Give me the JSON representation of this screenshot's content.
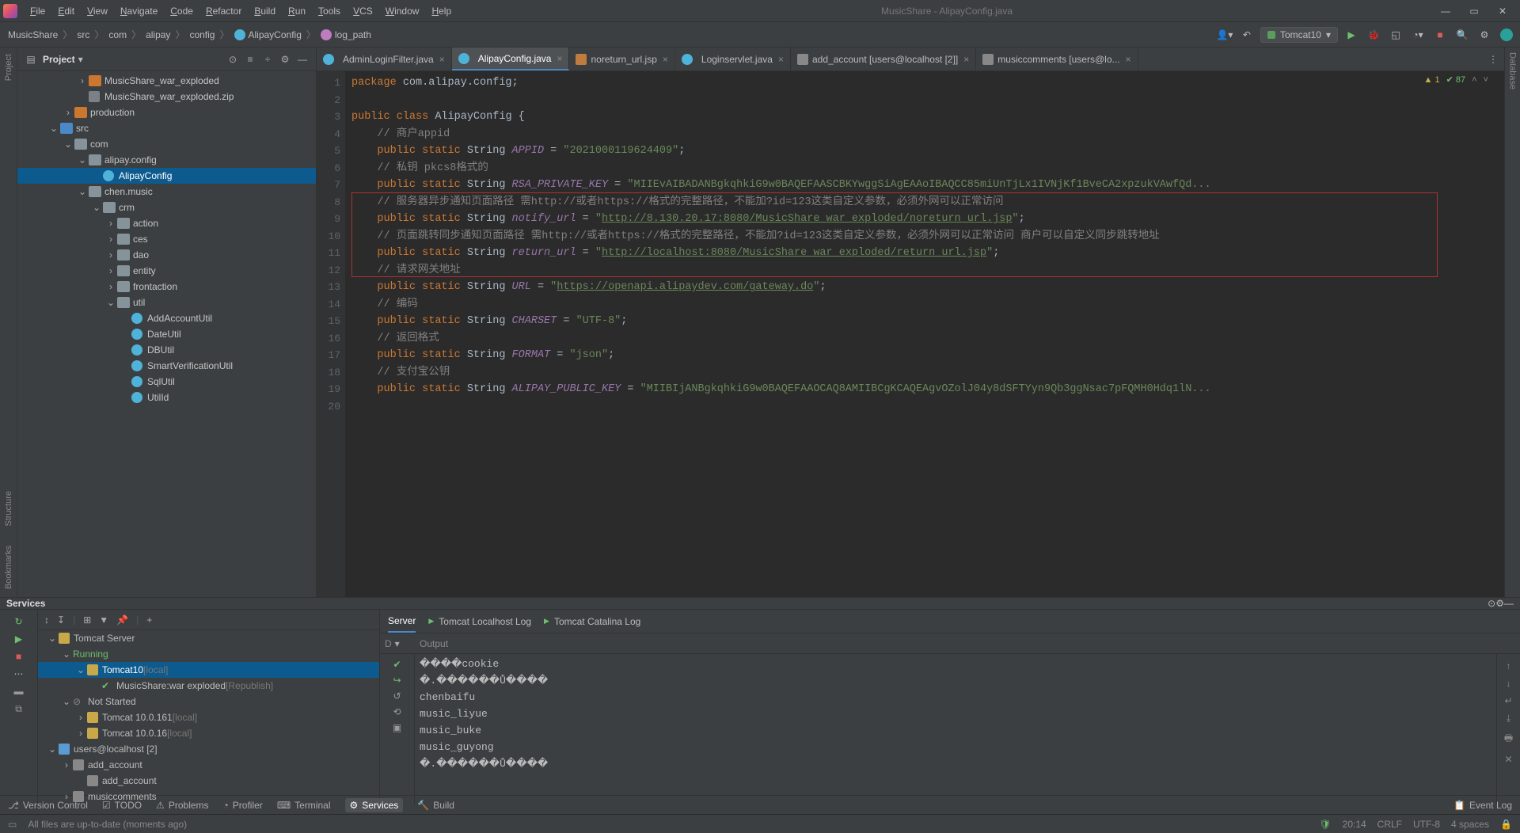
{
  "window": {
    "title": "MusicShare - AlipayConfig.java",
    "menus": [
      "File",
      "Edit",
      "View",
      "Navigate",
      "Code",
      "Refactor",
      "Build",
      "Run",
      "Tools",
      "VCS",
      "Window",
      "Help"
    ]
  },
  "breadcrumbs": [
    "MusicShare",
    "src",
    "com",
    "alipay",
    "config",
    "AlipayConfig",
    "log_path"
  ],
  "run_config": "Tomcat10",
  "project": {
    "title": "Project",
    "tree": [
      {
        "d": 3,
        "tw": ">",
        "ic": "folder orange",
        "t": "MusicShare_war_exploded"
      },
      {
        "d": 3,
        "tw": "",
        "ic": "zip",
        "t": "MusicShare_war_exploded.zip"
      },
      {
        "d": 2,
        "tw": ">",
        "ic": "folder orange",
        "t": "production"
      },
      {
        "d": 1,
        "tw": "v",
        "ic": "folder blue",
        "t": "src"
      },
      {
        "d": 2,
        "tw": "v",
        "ic": "folder",
        "t": "com"
      },
      {
        "d": 3,
        "tw": "v",
        "ic": "folder",
        "t": "alipay.config"
      },
      {
        "d": 4,
        "tw": "",
        "ic": "ficon",
        "t": "AlipayConfig",
        "sel": true
      },
      {
        "d": 3,
        "tw": "v",
        "ic": "folder",
        "t": "chen.music"
      },
      {
        "d": 4,
        "tw": "v",
        "ic": "folder",
        "t": "crm"
      },
      {
        "d": 5,
        "tw": ">",
        "ic": "folder",
        "t": "action"
      },
      {
        "d": 5,
        "tw": ">",
        "ic": "folder",
        "t": "ces"
      },
      {
        "d": 5,
        "tw": ">",
        "ic": "folder",
        "t": "dao"
      },
      {
        "d": 5,
        "tw": ">",
        "ic": "folder",
        "t": "entity"
      },
      {
        "d": 5,
        "tw": ">",
        "ic": "folder",
        "t": "frontaction"
      },
      {
        "d": 5,
        "tw": "v",
        "ic": "folder",
        "t": "util"
      },
      {
        "d": 6,
        "tw": "",
        "ic": "ficon",
        "t": "AddAccountUtil"
      },
      {
        "d": 6,
        "tw": "",
        "ic": "ficon",
        "t": "DateUtil"
      },
      {
        "d": 6,
        "tw": "",
        "ic": "ficon",
        "t": "DBUtil"
      },
      {
        "d": 6,
        "tw": "",
        "ic": "ficon",
        "t": "SmartVerificationUtil"
      },
      {
        "d": 6,
        "tw": "",
        "ic": "ficon",
        "t": "SqlUtil"
      },
      {
        "d": 6,
        "tw": "",
        "ic": "ficon",
        "t": "UtilId"
      }
    ]
  },
  "editor": {
    "tabs": [
      {
        "icon": "c",
        "label": "AdminLoginFilter.java",
        "active": false
      },
      {
        "icon": "c",
        "label": "AlipayConfig.java",
        "active": true
      },
      {
        "icon": "jsp",
        "label": "noreturn_url.jsp",
        "active": false
      },
      {
        "icon": "c",
        "label": "Loginservlet.java",
        "active": false
      },
      {
        "icon": "db",
        "label": "add_account [users@localhost [2]]",
        "active": false
      },
      {
        "icon": "db",
        "label": "musiccomments [users@lo...",
        "active": false
      }
    ],
    "inspection": {
      "warn": "1",
      "ok": "87"
    },
    "lines": [
      {
        "n": 1,
        "seg": [
          [
            "kw",
            "package "
          ],
          [
            "cls",
            "com.alipay.config"
          ],
          [
            "cls",
            ";"
          ]
        ]
      },
      {
        "n": 2,
        "seg": []
      },
      {
        "n": 3,
        "seg": [
          [
            "kw",
            "public class "
          ],
          [
            "cls",
            "AlipayConfig {"
          ]
        ]
      },
      {
        "n": 4,
        "seg": [
          [
            "",
            "    "
          ],
          [
            "cmt",
            "// 商户appid"
          ]
        ]
      },
      {
        "n": 5,
        "seg": [
          [
            "",
            "    "
          ],
          [
            "kw",
            "public static "
          ],
          [
            "cls",
            "String "
          ],
          [
            "fld",
            "APPID"
          ],
          [
            "cls",
            " = "
          ],
          [
            "str",
            "\"2021000119624409\""
          ],
          [
            "cls",
            ";"
          ]
        ]
      },
      {
        "n": 6,
        "seg": [
          [
            "",
            "    "
          ],
          [
            "cmt",
            "// 私钥 pkcs8格式的"
          ]
        ]
      },
      {
        "n": 7,
        "seg": [
          [
            "",
            "    "
          ],
          [
            "kw",
            "public static "
          ],
          [
            "cls",
            "String "
          ],
          [
            "fld",
            "RSA_PRIVATE_KEY"
          ],
          [
            "cls",
            " = "
          ],
          [
            "str",
            "\"MIIEvAIBADANBgkqhkiG9w0BAQEFAASCBKYwggSiAgEAAoIBAQCC85miUnTjLx1IVNjKf1BveCA2xpzukVAwfQd..."
          ]
        ]
      },
      {
        "n": 8,
        "seg": [
          [
            "",
            "    "
          ],
          [
            "cmt",
            "// 服务器异步通知页面路径 需http://或者https://格式的完整路径，不能加?id=123这类自定义参数，必须外网可以正常访问"
          ]
        ]
      },
      {
        "n": 9,
        "seg": [
          [
            "",
            "    "
          ],
          [
            "kw",
            "public static "
          ],
          [
            "cls",
            "String "
          ],
          [
            "fld",
            "notify_url"
          ],
          [
            "cls",
            " = "
          ],
          [
            "str",
            "\""
          ],
          [
            "lnk",
            "http://8.130.20.17:8080/MusicShare_war_exploded/noreturn_url.jsp"
          ],
          [
            "str",
            "\""
          ],
          [
            "cls",
            ";"
          ]
        ]
      },
      {
        "n": 10,
        "seg": [
          [
            "",
            "    "
          ],
          [
            "cmt",
            "// 页面跳转同步通知页面路径 需http://或者https://格式的完整路径，不能加?id=123这类自定义参数，必须外网可以正常访问 商户可以自定义同步跳转地址"
          ]
        ]
      },
      {
        "n": 11,
        "seg": [
          [
            "",
            "    "
          ],
          [
            "kw",
            "public static "
          ],
          [
            "cls",
            "String "
          ],
          [
            "fld",
            "return_url"
          ],
          [
            "cls",
            " = "
          ],
          [
            "str",
            "\""
          ],
          [
            "lnk",
            "http://localhost:8080/MusicShare_war_exploded/return_url.jsp"
          ],
          [
            "str",
            "\""
          ],
          [
            "cls",
            ";"
          ]
        ]
      },
      {
        "n": 12,
        "seg": [
          [
            "",
            "    "
          ],
          [
            "cmt",
            "// 请求网关地址"
          ]
        ]
      },
      {
        "n": 13,
        "seg": [
          [
            "",
            "    "
          ],
          [
            "kw",
            "public static "
          ],
          [
            "cls",
            "String "
          ],
          [
            "fld",
            "URL"
          ],
          [
            "cls",
            " = "
          ],
          [
            "str",
            "\""
          ],
          [
            "lnk",
            "https://openapi.alipaydev.com/gateway.do"
          ],
          [
            "str",
            "\""
          ],
          [
            "cls",
            ";"
          ]
        ]
      },
      {
        "n": 14,
        "seg": [
          [
            "",
            "    "
          ],
          [
            "cmt",
            "// 编码"
          ]
        ]
      },
      {
        "n": 15,
        "seg": [
          [
            "",
            "    "
          ],
          [
            "kw",
            "public static "
          ],
          [
            "cls",
            "String "
          ],
          [
            "fld",
            "CHARSET"
          ],
          [
            "cls",
            " = "
          ],
          [
            "str",
            "\"UTF-8\""
          ],
          [
            "cls",
            ";"
          ]
        ]
      },
      {
        "n": 16,
        "seg": [
          [
            "",
            "    "
          ],
          [
            "cmt",
            "// 返回格式"
          ]
        ]
      },
      {
        "n": 17,
        "seg": [
          [
            "",
            "    "
          ],
          [
            "kw",
            "public static "
          ],
          [
            "cls",
            "String "
          ],
          [
            "fld",
            "FORMAT"
          ],
          [
            "cls",
            " = "
          ],
          [
            "str",
            "\"json\""
          ],
          [
            "cls",
            ";"
          ]
        ]
      },
      {
        "n": 18,
        "seg": [
          [
            "",
            "    "
          ],
          [
            "cmt",
            "// 支付宝公钥"
          ]
        ]
      },
      {
        "n": 19,
        "seg": [
          [
            "",
            "    "
          ],
          [
            "kw",
            "public static "
          ],
          [
            "cls",
            "String "
          ],
          [
            "fld",
            "ALIPAY_PUBLIC_KEY"
          ],
          [
            "cls",
            " = "
          ],
          [
            "str",
            "\"MIIBIjANBgkqhkiG9w0BAQEFAAOCAQ8AMIIBCgKCAQEAgvOZolJ04y8dSFTYyn9Qb3ggNsac7pFQMH0Hdq1lN..."
          ]
        ]
      },
      {
        "n": 20,
        "seg": []
      }
    ],
    "highlight_box": {
      "top_line": 8,
      "bottom_line": 12
    }
  },
  "services": {
    "title": "Services",
    "tree": [
      {
        "d": 0,
        "tw": "v",
        "t": "Tomcat Server",
        "ic": "tom"
      },
      {
        "d": 1,
        "tw": "v",
        "t": "Running",
        "cls": "green"
      },
      {
        "d": 2,
        "tw": "v",
        "t": "Tomcat10",
        "suffix": "[local]",
        "sel": true,
        "ic": "tom"
      },
      {
        "d": 3,
        "tw": "",
        "t": "MusicShare:war exploded",
        "suffix": "[Republish]",
        "ic": "ok"
      },
      {
        "d": 1,
        "tw": "v",
        "t": "Not Started",
        "ic": "ban"
      },
      {
        "d": 2,
        "tw": ">",
        "t": "Tomcat 10.0.161",
        "suffix": "[local]",
        "ic": "tom"
      },
      {
        "d": 2,
        "tw": ">",
        "t": "Tomcat 10.0.16",
        "suffix": "[local]",
        "ic": "tom"
      },
      {
        "d": 0,
        "tw": "v",
        "t": "users@localhost [2]",
        "ic": "db"
      },
      {
        "d": 1,
        "tw": ">",
        "t": "add_account",
        "ic": "tbl"
      },
      {
        "d": 2,
        "tw": "",
        "t": "add_account",
        "ic": "tbl"
      },
      {
        "d": 1,
        "tw": ">",
        "t": "musiccomments",
        "ic": "tbl"
      }
    ],
    "server_tabs": [
      "Server",
      "Tomcat Localhost Log",
      "Tomcat Catalina Log"
    ],
    "output_label": "Output",
    "console": [
      "����cookie",
      "�.������Ů����",
      "chenbaifu",
      "music_liyue",
      "music_buke",
      "music_guyong",
      "�.������Ů����"
    ]
  },
  "bottom_tabs": [
    {
      "label": "Version Control",
      "ic": "git"
    },
    {
      "label": "TODO",
      "ic": "todo"
    },
    {
      "label": "Problems",
      "ic": "warn"
    },
    {
      "label": "Profiler",
      "ic": "prof"
    },
    {
      "label": "Terminal",
      "ic": "term"
    },
    {
      "label": "Services",
      "ic": "svc",
      "active": true
    },
    {
      "label": "Build",
      "ic": "build"
    }
  ],
  "event_log": "Event Log",
  "status": {
    "msg": "All files are up-to-date (moments ago)",
    "time": "20:14",
    "le": "CRLF",
    "enc": "UTF-8",
    "indent": "4 spaces"
  }
}
